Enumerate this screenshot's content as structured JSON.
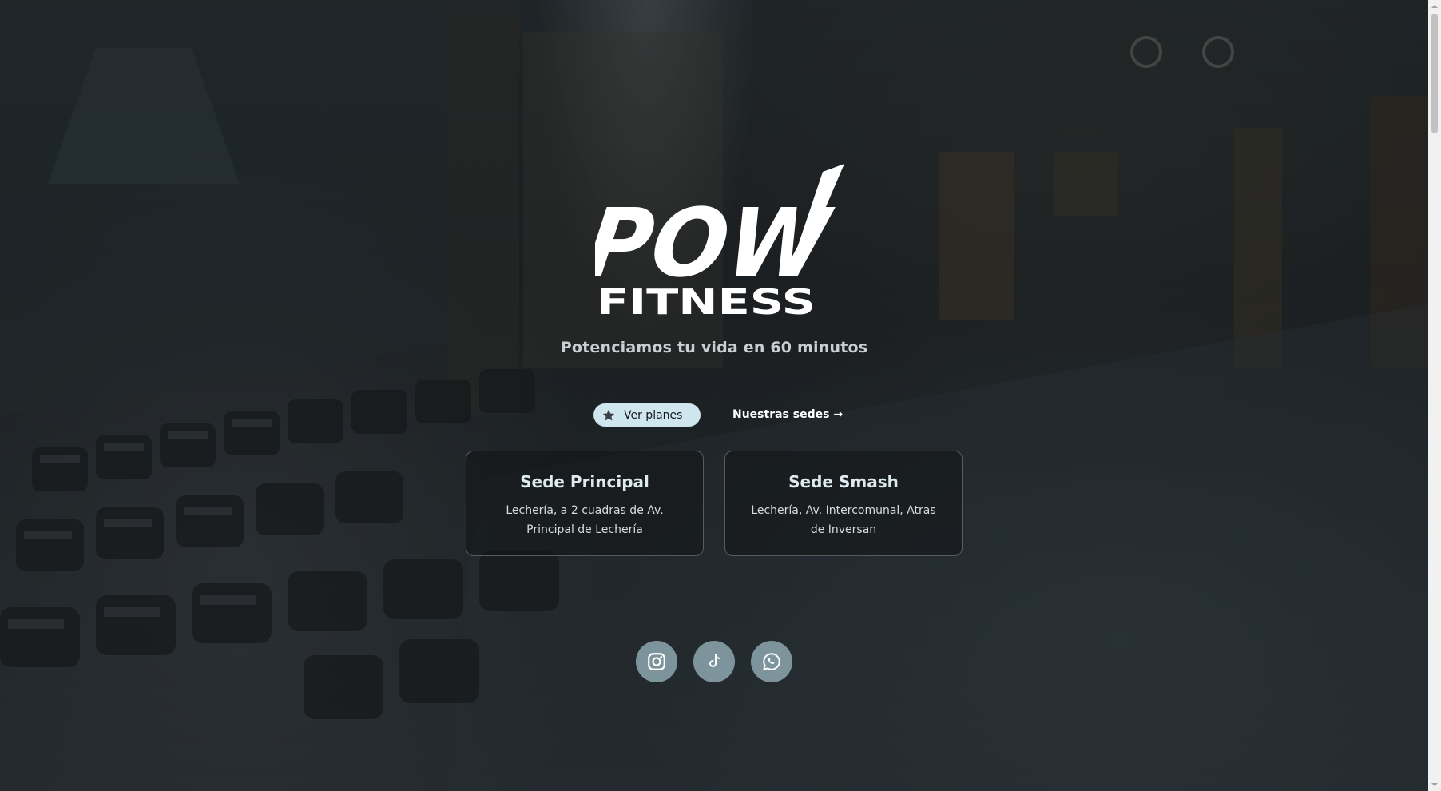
{
  "brand": {
    "logo_script": "POW",
    "logo_word": "FITNESS",
    "tagline": "Potenciamos tu vida en 60 minutos"
  },
  "cta": {
    "primary_label": "Ver planes",
    "primary_icon": "star-icon",
    "secondary_label": "Nuestras sedes →"
  },
  "locations": [
    {
      "name": "Sede Principal",
      "address": "Lechería, a 2 cuadras de Av. Principal de Lechería"
    },
    {
      "name": "Sede Smash",
      "address": "Lechería, Av. Intercomunal, Atras de Inversan"
    }
  ],
  "socials": [
    {
      "icon": "instagram-icon"
    },
    {
      "icon": "tiktok-icon"
    },
    {
      "icon": "whatsapp-icon"
    }
  ],
  "colors": {
    "primary_button_bg": "#cfe6ee",
    "social_button_bg": "#7e949c",
    "card_border": "#a0aab2"
  }
}
